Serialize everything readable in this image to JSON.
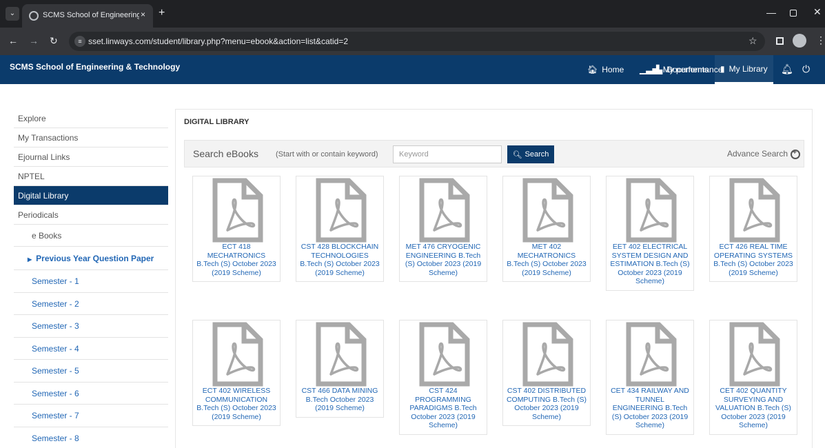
{
  "browser": {
    "tab_title": "SCMS School of Engineering &",
    "tab_close": "×",
    "new_tab": "+",
    "url": "sset.linways.com/student/library.php?menu=ebook&action=list&catid=2"
  },
  "header": {
    "brand": "SCMS School of Engineering & Technology",
    "nav": [
      {
        "label": "Home",
        "icon": "home-icon"
      },
      {
        "label": "My performance",
        "icon": "bar-chart-icon"
      },
      {
        "label": "Documents",
        "icon": "document-icon"
      },
      {
        "label": "My Library",
        "icon": "book-icon",
        "active": true
      }
    ]
  },
  "sidebar": {
    "items": [
      "Explore",
      "My Transactions",
      "Ejournal Links",
      "NPTEL",
      "Digital Library",
      "Periodicals"
    ],
    "active": "Digital Library",
    "ebooks": "e Books",
    "folder": "Previous Year Question Paper",
    "semesters": [
      "Semester - 1",
      "Semester - 2",
      "Semester - 3",
      "Semester - 4",
      "Semester - 5",
      "Semester - 6",
      "Semester - 7",
      "Semester - 8"
    ]
  },
  "main": {
    "title": "DIGITAL LIBRARY",
    "search": {
      "label": "Search eBooks",
      "hint": "(Start with or contain keyword)",
      "placeholder": "Keyword",
      "button": "Search",
      "advanced": "Advance Search"
    },
    "books": [
      "ECT 418 MECHATRONICS B.Tech (S) October 2023 (2019 Scheme)",
      "CST 428 BLOCKCHAIN TECHNOLOGIES B.Tech (S) October 2023 (2019 Scheme)",
      "MET 476 CRYOGENIC ENGINEERING B.Tech (S) October 2023 (2019 Scheme)",
      "MET 402 MECHATRONICS B.Tech (S) October 2023 (2019 Scheme)",
      "EET 402 ELECTRICAL SYSTEM DESIGN AND ESTIMATION B.Tech (S) October 2023 (2019 Scheme)",
      "ECT 426 REAL TIME OPERATING SYSTEMS B.Tech (S) October 2023 (2019 Scheme)",
      "ECT 402 WIRELESS COMMUNICATION B.Tech (S) October 2023 (2019 Scheme)",
      "CST 466 DATA MINING B.Tech October 2023 (2019 Scheme)",
      "CST 424 PROGRAMMING PARADIGMS B.Tech October 2023 (2019 Scheme)",
      "CST 402 DISTRIBUTED COMPUTING B.Tech (S) October 2023 (2019 Scheme)",
      "CET 434 RAILWAY AND TUNNEL ENGINEERING B.Tech (S) October 2023 (2019 Scheme)",
      "CET 402 QUANTITY SURVEYING AND VALUATION B.Tech (S) October 2023 (2019 Scheme)"
    ]
  },
  "colors": {
    "brand_blue": "#0b3b6b",
    "link_blue": "#2267b5",
    "pdf_gray": "#a9a9a9"
  }
}
